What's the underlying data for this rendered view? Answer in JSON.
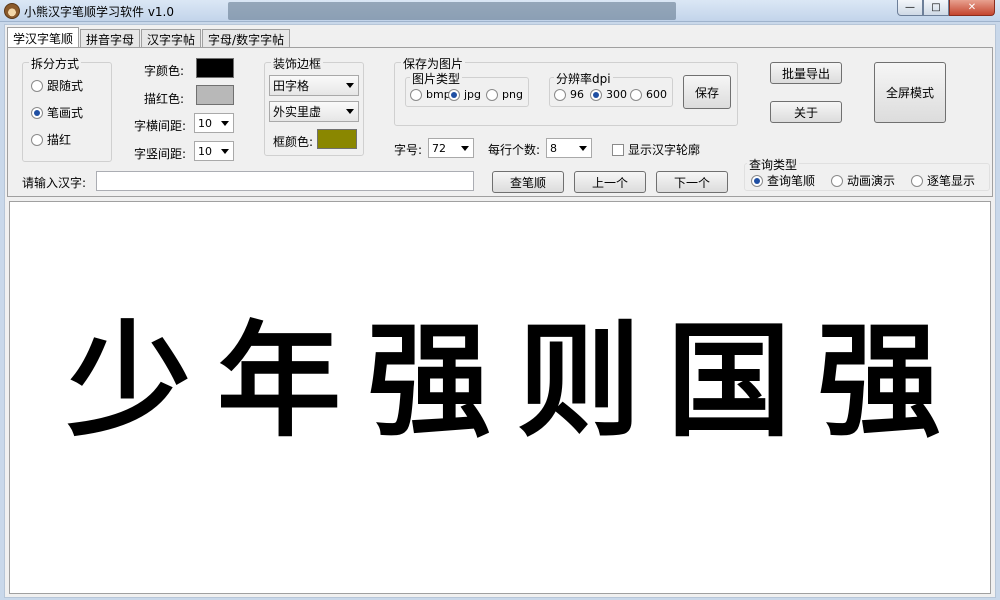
{
  "window": {
    "title": "小熊汉字笔顺学习软件 v1.0",
    "controls": {
      "minimize": "—",
      "maximize": "□",
      "close": "✕"
    }
  },
  "tabs": [
    "学汉字笔顺",
    "拼音字母",
    "汉字字帖",
    "字母/数字字帖"
  ],
  "split": {
    "title": "拆分方式",
    "options": [
      "跟随式",
      "笔画式",
      "描红"
    ],
    "selected": 1
  },
  "colors": {
    "char_color_label": "字颜色:",
    "char_color": "#000000",
    "trace_color_label": "描红色:",
    "trace_color": "#b8b8b8",
    "frame_color_label": "框颜色:",
    "frame_color": "#8a8700"
  },
  "spacing": {
    "h_label": "字横间距:",
    "h_value": "10",
    "v_label": "字竖间距:",
    "v_value": "10"
  },
  "border": {
    "title": "装饰边框",
    "style": "田字格",
    "line": "外实里虚"
  },
  "save": {
    "title": "保存为图片",
    "type_title": "图片类型",
    "types": [
      "bmp",
      "jpg",
      "png"
    ],
    "type_selected": 1,
    "dpi_title": "分辨率dpi",
    "dpis": [
      "96",
      "300",
      "600"
    ],
    "dpi_selected": 1,
    "save_button": "保存"
  },
  "buttons": {
    "batch_export": "批量导出",
    "about": "关于",
    "fullscreen": "全屏模式",
    "lookup": "查笔顺",
    "prev": "上一个",
    "next": "下一个"
  },
  "font": {
    "size_label": "字号:",
    "size_value": "72",
    "per_row_label": "每行个数:",
    "per_row_value": "8",
    "outline_label": "显示汉字轮廓"
  },
  "input": {
    "label": "请输入汉字:",
    "value": ""
  },
  "query": {
    "title": "查询类型",
    "options": [
      "查询笔顺",
      "动画演示",
      "逐笔显示"
    ],
    "selected": 0
  },
  "canvas": {
    "characters": [
      "少",
      "年",
      "强",
      "则",
      "国",
      "强"
    ]
  }
}
